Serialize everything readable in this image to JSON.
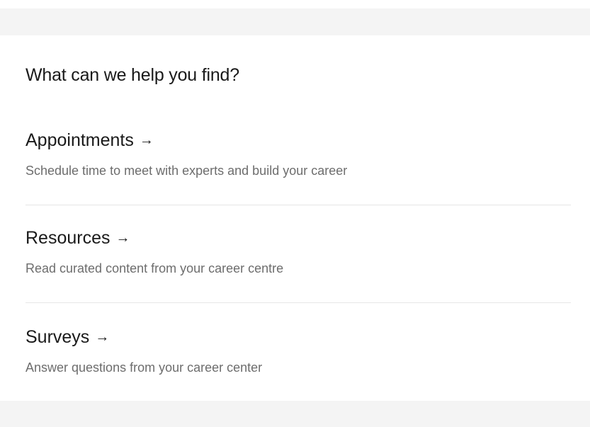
{
  "heading": "What can we help you find?",
  "sections": [
    {
      "title": "Appointments",
      "arrow": "→",
      "description": "Schedule time to meet with experts and build your career"
    },
    {
      "title": "Resources",
      "arrow": "→",
      "description": "Read curated content from your career centre"
    },
    {
      "title": "Surveys",
      "arrow": "→",
      "description": "Answer questions from your career center"
    }
  ],
  "colors": {
    "background": "#f4f4f4",
    "card": "#ffffff",
    "text": "#1a1a1a",
    "muted": "#6d6d6d",
    "divider": "#e6e6e6"
  }
}
